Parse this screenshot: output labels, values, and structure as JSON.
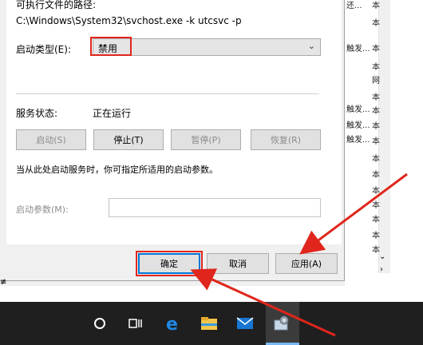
{
  "dialog": {
    "path_label": "可执行文件的路径:",
    "path_value": "C:\\Windows\\System32\\svchost.exe -k utcsvc -p",
    "startup_type_label": "启动类型(E):",
    "startup_type_value": "禁用",
    "service_status_label": "服务状态:",
    "service_status_value": "正在运行",
    "buttons": {
      "start": "启动(S)",
      "stop": "停止(T)",
      "pause": "暂停(P)",
      "resume": "恢复(R)"
    },
    "hint": "当从此处启动服务时，你可指定所适用的启动参数。",
    "start_params_label": "启动参数(M):",
    "start_params_value": "",
    "ok": "确定",
    "cancel": "取消",
    "apply": "应用(A)"
  },
  "background_list": {
    "top_text": "还...",
    "rows": [
      "触发...",
      "触发...",
      "触发...",
      "触发..."
    ],
    "marks": [
      "本",
      "本",
      "本",
      "本",
      "网",
      "本",
      "本",
      "本",
      "本",
      "本",
      "本",
      "本",
      "本",
      "本",
      "本",
      "本",
      "本",
      "本",
      "本",
      "本"
    ]
  },
  "taskbar": {
    "icons": [
      "search-circle-icon",
      "task-view-icon",
      "edge-icon",
      "file-explorer-icon",
      "mail-icon",
      "services-app-icon"
    ]
  },
  "colors": {
    "highlight_red": "#e0261c",
    "focus_blue": "#0078d7",
    "taskbar": "#1f1f1f"
  }
}
